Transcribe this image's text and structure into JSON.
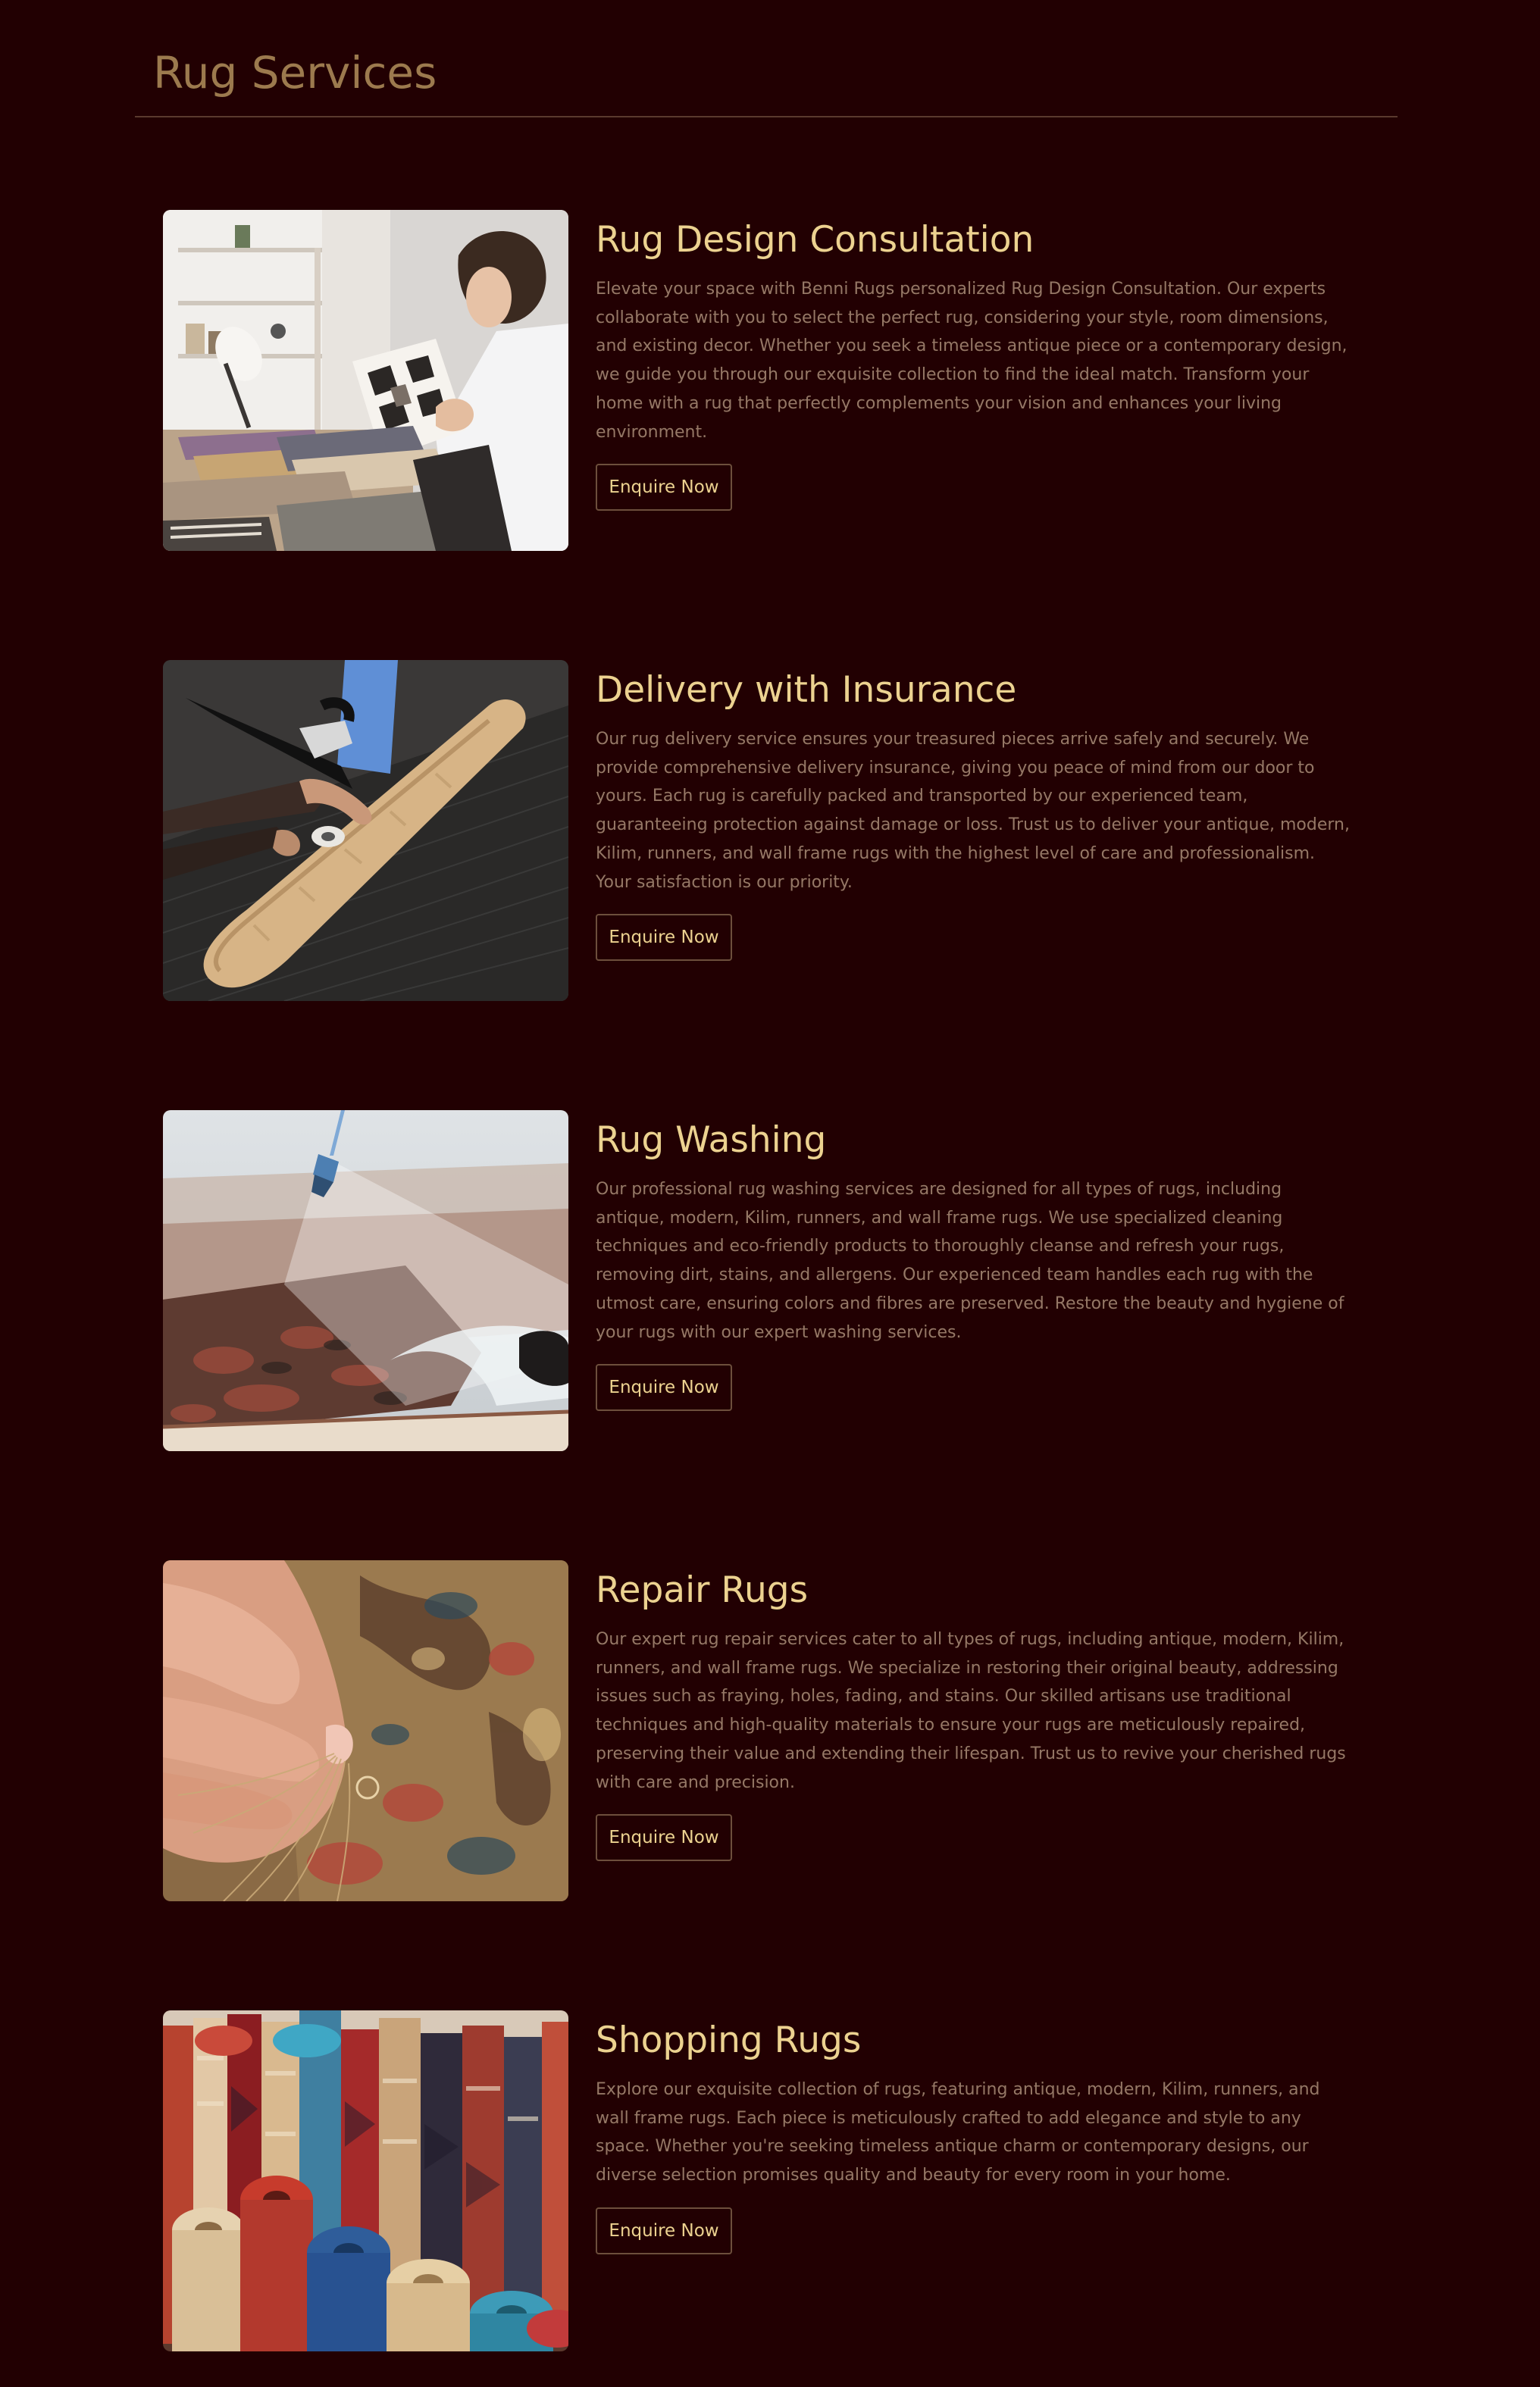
{
  "header": {
    "title": "Rug Services"
  },
  "services": [
    {
      "title": "Rug Design Consultation",
      "description": "Elevate your space with Benni Rugs personalized Rug Design Consultation. Our experts collaborate with you to select the perfect rug, considering your style, room dimensions, and existing decor. Whether you seek a timeless antique piece or a contemporary design, we guide you through our exquisite collection to find the ideal match. Transform your home with a rug that perfectly complements your vision and enhances your living environment.",
      "button_label": "Enquire Now",
      "image_alt": "Designer reviewing rug pattern samples"
    },
    {
      "title": "Delivery with Insurance",
      "description": "Our rug delivery service ensures your treasured pieces arrive safely and securely. We provide comprehensive delivery insurance, giving you peace of mind from our door to yours. Each rug is carefully packed and transported by our experienced team, guaranteeing protection against damage or loss. Trust us to deliver your antique, modern, Kilim, runners, and wall frame rugs with the highest level of care and professionalism. Your satisfaction is our priority.",
      "button_label": "Enquire Now",
      "image_alt": "Rug being wrapped and taped for delivery"
    },
    {
      "title": "Rug Washing",
      "description": "Our professional rug washing services are designed for all types of rugs, including antique, modern, Kilim, runners, and wall frame rugs. We use specialized cleaning techniques and eco-friendly products to thoroughly cleanse and refresh your rugs, removing dirt, stains, and allergens. Our experienced team handles each rug with the utmost care, ensuring colors and fibres are preserved. Restore the beauty and hygiene of your rugs with our expert washing services.",
      "button_label": "Enquire Now",
      "image_alt": "Rug being pressure washed"
    },
    {
      "title": "Repair Rugs",
      "description": "Our expert rug repair services cater to all types of rugs, including antique, modern, Kilim, runners, and wall frame rugs. We specialize in restoring their original beauty, addressing issues such as fraying, holes, fading, and stains. Our skilled artisans use traditional techniques and high-quality materials to ensure your rugs are meticulously repaired, preserving their value and extending their lifespan. Trust us to revive your cherished rugs with care and precision.",
      "button_label": "Enquire Now",
      "image_alt": "Hands repairing a rug with thread"
    },
    {
      "title": "Shopping Rugs",
      "description": "Explore our exquisite collection of rugs, featuring antique, modern, Kilim, runners, and wall frame rugs. Each piece is meticulously crafted to add elegance and style to any space. Whether you're seeking timeless antique charm or contemporary designs, our diverse selection promises quality and beauty for every room in your home.",
      "button_label": "Enquire Now",
      "image_alt": "Rolled rugs displayed at a market"
    }
  ],
  "colors": {
    "background": "#220002",
    "page_title": "#9c7a4e",
    "service_title": "#ecd290",
    "body_text": "#957866",
    "button_border": "#6d4f3c",
    "rule": "#5a3a2e"
  }
}
